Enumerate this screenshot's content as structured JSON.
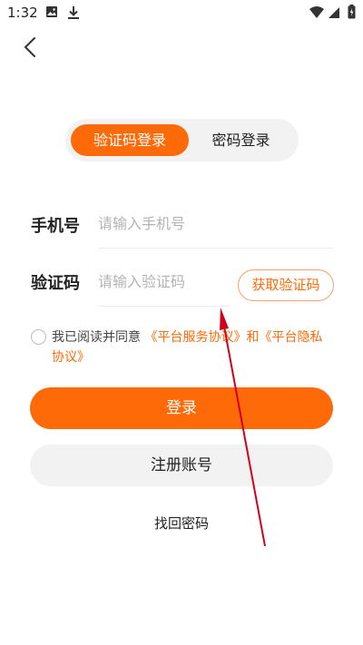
{
  "status_bar": {
    "time": "1:32",
    "icons": [
      "image-icon",
      "download-icon",
      "wifi-icon",
      "signal-icon",
      "battery-icon"
    ]
  },
  "nav": {
    "back_icon": "chevron-left-icon"
  },
  "tabs": [
    {
      "label": "验证码登录",
      "active": true
    },
    {
      "label": "密码登录",
      "active": false
    }
  ],
  "form": {
    "phone": {
      "label": "手机号",
      "placeholder": "请输入手机号",
      "value": ""
    },
    "code": {
      "label": "验证码",
      "placeholder": "请输入验证码",
      "value": "",
      "get_code_label": "获取验证码"
    }
  },
  "agreement": {
    "checked": false,
    "prefix": "我已阅读并同意",
    "link1": "《平台服务协议》",
    "joiner": "和",
    "link2": "《平台隐私协议》"
  },
  "actions": {
    "login_label": "登录",
    "register_label": "注册账号",
    "forgot_label": "找回密码"
  },
  "colors": {
    "accent": "#ff6a08",
    "annotation": "#d0021b"
  }
}
